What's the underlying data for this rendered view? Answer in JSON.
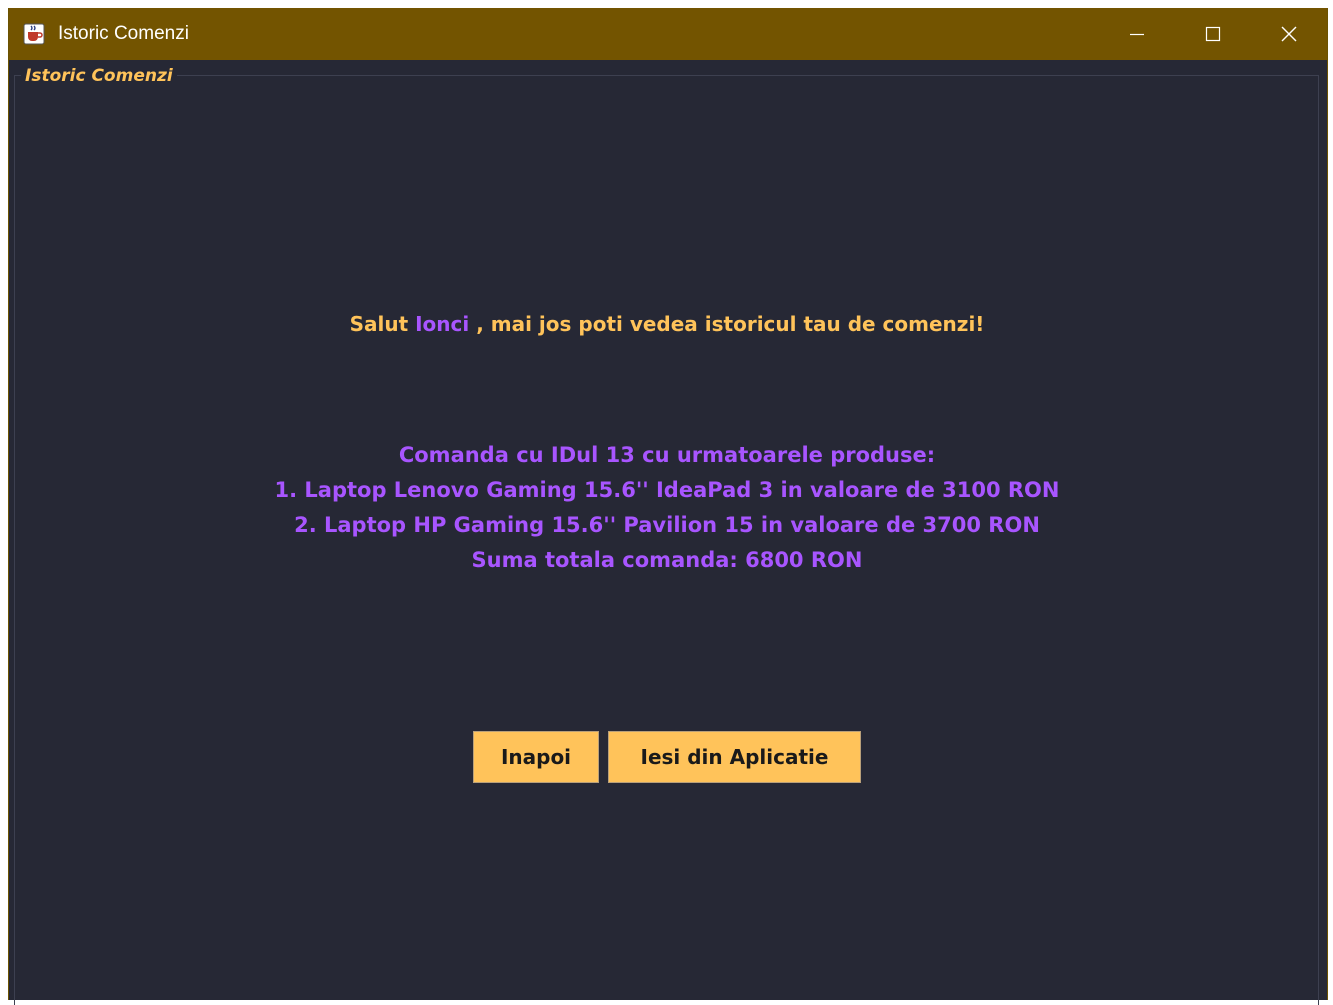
{
  "window": {
    "title": "Istoric Comenzi",
    "app_icon": "java-cup-icon",
    "controls": {
      "minimize_icon": "minimize-icon",
      "maximize_icon": "maximize-icon",
      "close_icon": "close-icon"
    }
  },
  "panel": {
    "title": "Istoric Comenzi"
  },
  "greeting": {
    "prefix": "Salut ",
    "username": "Ionci",
    "suffix": " , mai jos poti vedea istoricul tau de comenzi!"
  },
  "order": {
    "header": "Comanda cu IDul 13 cu urmatoarele produse:",
    "items": [
      "1. Laptop Lenovo Gaming 15.6'' IdeaPad 3 in valoare de 3100 RON",
      "2. Laptop HP Gaming 15.6'' Pavilion 15 in valoare de 3700 RON"
    ],
    "total": "Suma totala comanda: 6800 RON"
  },
  "buttons": {
    "back_label": "Inapoi",
    "exit_label": "Iesi din Aplicatie"
  },
  "colors": {
    "titlebar": "#735400",
    "background": "#262835",
    "accent_yellow": "#ffc35a",
    "accent_purple": "#a855ff",
    "button_bg": "#ffc35a"
  }
}
